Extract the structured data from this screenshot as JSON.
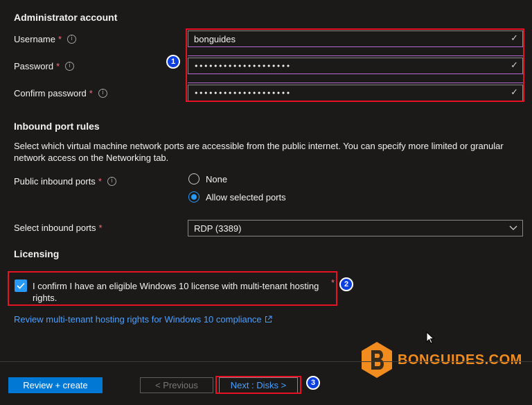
{
  "admin": {
    "title": "Administrator account",
    "username_label": "Username",
    "username_value": "bonguides",
    "password_label": "Password",
    "password_value": "••••••••••••••••••••",
    "confirm_label": "Confirm password",
    "confirm_value": "••••••••••••••••••••",
    "required_mark": "*",
    "info_glyph": "i",
    "valid_glyph": "✓"
  },
  "inbound": {
    "title": "Inbound port rules",
    "description": "Select which virtual machine network ports are accessible from the public internet. You can specify more limited or granular network access on the Networking tab.",
    "public_label": "Public inbound ports",
    "options": [
      "None",
      "Allow selected ports"
    ],
    "selected_option": "Allow selected ports",
    "select_label": "Select inbound ports",
    "select_value": "RDP (3389)"
  },
  "licensing": {
    "title": "Licensing",
    "confirm_text": "I confirm I have an eligible Windows 10 license with multi-tenant hosting rights.",
    "confirm_checked": true,
    "review_link": "Review multi-tenant hosting rights for Windows 10 compliance"
  },
  "footer": {
    "review_create": "Review + create",
    "previous": "< Previous",
    "next": "Next : Disks >"
  },
  "annotations": [
    "1",
    "2",
    "3"
  ],
  "watermark": "BONGUIDES.COM",
  "colors": {
    "background": "#1b1a19",
    "accent": "#2899f5",
    "primary_button": "#0078d4",
    "link": "#4aa0ff",
    "annotation_border": "#e81123",
    "validation_line": "#b86bd6",
    "watermark_orange": "#f28c1e"
  }
}
